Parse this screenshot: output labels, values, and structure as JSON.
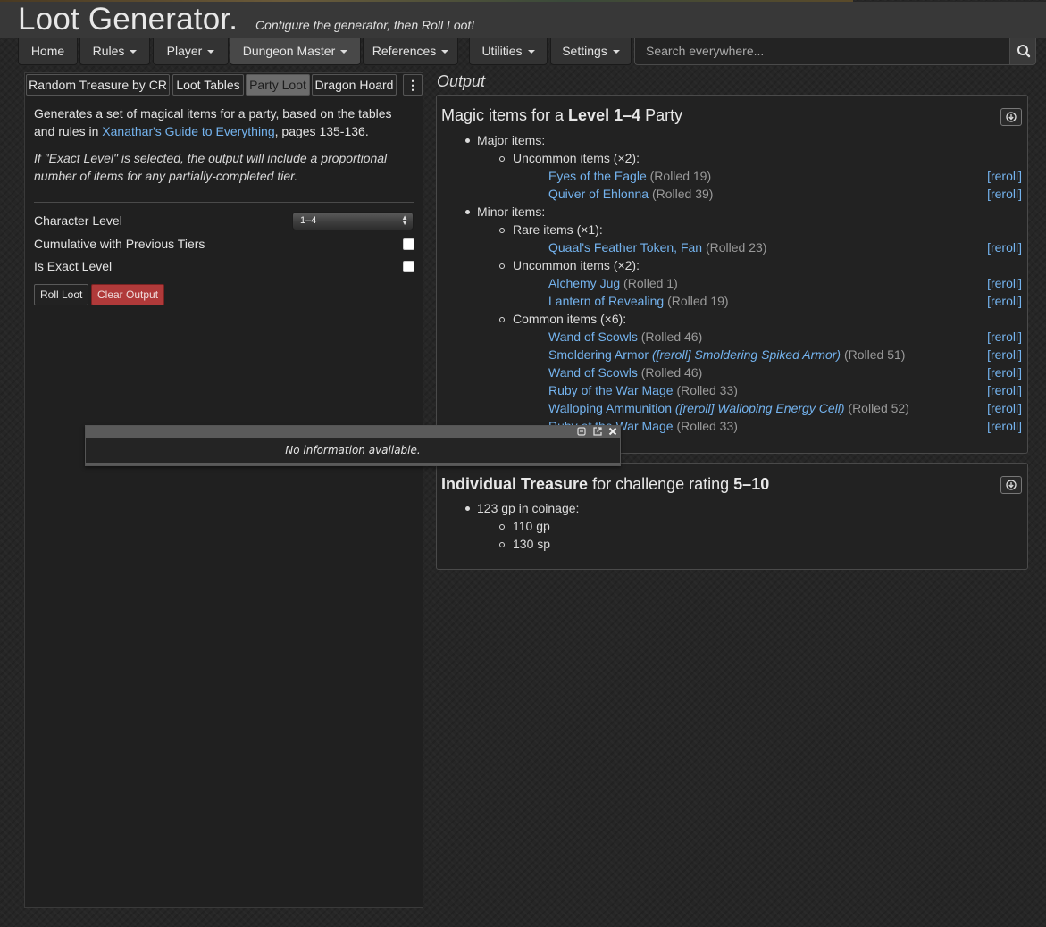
{
  "header": {
    "title": "Loot Generator.",
    "subtitle": "Configure the generator, then Roll Loot!"
  },
  "nav": {
    "items": [
      "Home",
      "Rules",
      "Player",
      "Dungeon Master",
      "References",
      "Utilities",
      "Settings"
    ],
    "search_placeholder": "Search everywhere..."
  },
  "left": {
    "tabs": [
      "Random Treasure by CR",
      "Loot Tables",
      "Party Loot",
      "Dragon Hoard",
      "⋮"
    ],
    "desc_pre": "Generates a set of magical items for a party, based on the tables and rules in ",
    "desc_link": "Xanathar's Guide to Everything",
    "desc_post": ", pages 135-136.",
    "note": "If \"Exact Level\" is selected, the output will include a proportional number of items for any partially-completed tier.",
    "character_level_label": "Character Level",
    "character_level_value": "1–4",
    "cumulative_label": "Cumulative with Previous Tiers",
    "exact_label": "Is Exact Level",
    "roll_button": "Roll Loot",
    "clear_button": "Clear Output"
  },
  "output": {
    "title": "Output",
    "card1": {
      "title_pre": "Magic items for a ",
      "title_bold": "Level 1–4",
      "title_post": " Party",
      "major_label": "Major items:",
      "major_uncommon_label": "Uncommon items (×2):",
      "major_uncommon": [
        {
          "name": "Eyes of the Eagle",
          "roll": "(Rolled 19)"
        },
        {
          "name": "Quiver of Ehlonna",
          "roll": "(Rolled 39)"
        }
      ],
      "minor_label": "Minor items:",
      "minor_rare_label": "Rare items (×1):",
      "minor_rare": [
        {
          "name": "Quaal's Feather Token, Fan",
          "roll": "(Rolled 23)"
        }
      ],
      "minor_uncommon_label": "Uncommon items (×2):",
      "minor_uncommon": [
        {
          "name": "Alchemy Jug",
          "roll": "(Rolled 1)"
        },
        {
          "name": "Lantern of Revealing",
          "roll": "(Rolled 19)"
        }
      ],
      "minor_common_label": "Common items (×6):",
      "minor_common": [
        {
          "name": "Wand of Scowls",
          "roll": "(Rolled 46)"
        },
        {
          "name": "Smoldering Armor",
          "sub_open": "(",
          "sub_reroll": "[reroll]",
          "sub_name": "Smoldering Spiked Armor",
          "sub_close": ")",
          "roll": "(Rolled 51)"
        },
        {
          "name": "Wand of Scowls",
          "roll": "(Rolled 46)"
        },
        {
          "name": "Ruby of the War Mage",
          "roll": "(Rolled 33)"
        },
        {
          "name": "Walloping Ammunition",
          "sub_open": "(",
          "sub_reroll": "[reroll]",
          "sub_name": "Walloping Energy Cell",
          "sub_close": ")",
          "roll": "(Rolled 52)"
        },
        {
          "name": "Ruby of the War Mage",
          "roll": "(Rolled 33)"
        }
      ],
      "reroll_label": "[reroll]"
    },
    "card2": {
      "title_bold1": "Individual Treasure",
      "title_mid": " for challenge rating ",
      "title_bold2": "5–10",
      "coinage_label": "123 gp in coinage:",
      "coins": [
        "110 gp",
        "130 sp"
      ]
    }
  },
  "popup": {
    "message": "No information available."
  }
}
